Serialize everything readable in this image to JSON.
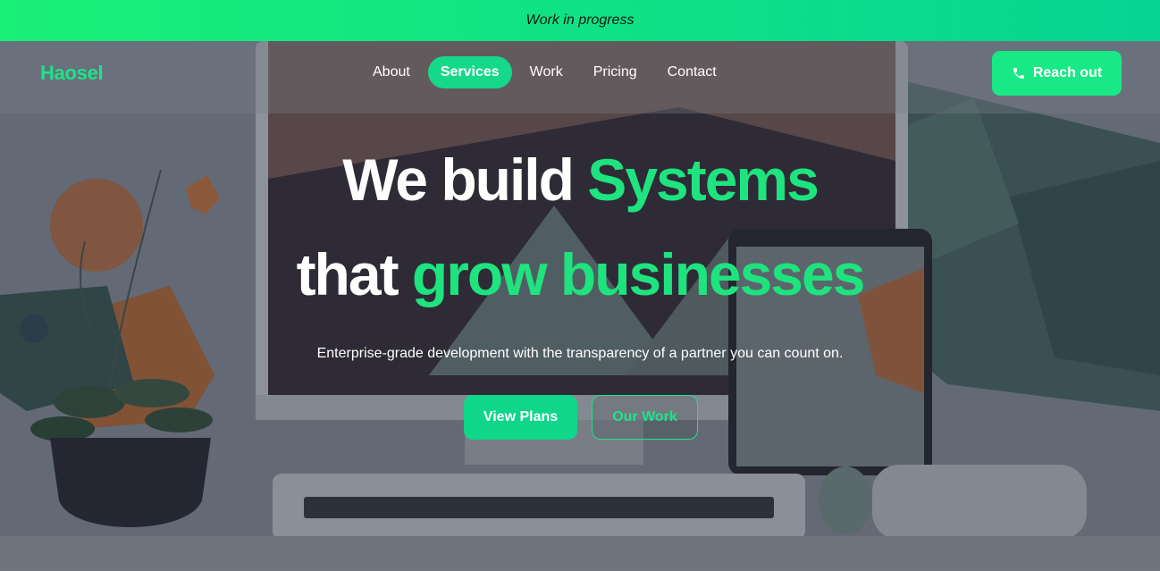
{
  "banner": {
    "text": "Work in progress"
  },
  "nav": {
    "logo": "Haosel",
    "items": [
      {
        "label": "About",
        "active": false
      },
      {
        "label": "Services",
        "active": true
      },
      {
        "label": "Work",
        "active": false
      },
      {
        "label": "Pricing",
        "active": false
      },
      {
        "label": "Contact",
        "active": false
      }
    ],
    "cta_label": "Reach out",
    "cta_icon": "phone-icon"
  },
  "hero": {
    "headline_line1_white": "We build ",
    "headline_line1_green": "Systems",
    "headline_line2_white": "that ",
    "headline_line2_green": "grow businesses",
    "subtitle": "Enterprise-grade development with the transparency of a partner you can count on.",
    "primary_button": "View Plans",
    "secondary_button": "Our Work"
  },
  "colors": {
    "accent": "#1ee38a",
    "button_green": "#10d68a",
    "banner_green": "#10e285"
  }
}
